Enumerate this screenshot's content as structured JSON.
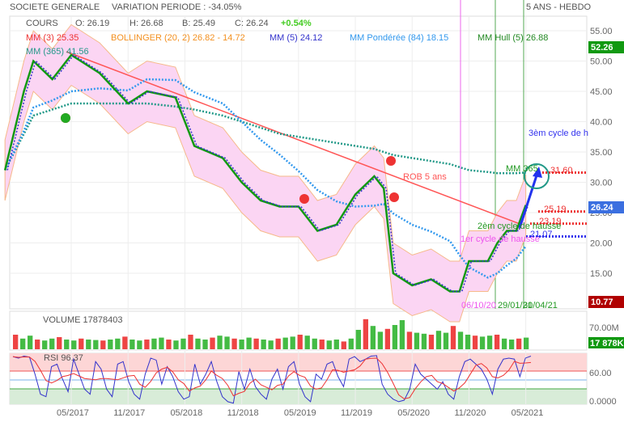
{
  "header": {
    "title": "SOCIETE GENERALE",
    "variation": "VARIATION PERIODE : -34.05%",
    "period": "5 ANS - HEBDO"
  },
  "quote": {
    "label": "COURS",
    "open": "O: 26.19",
    "high": "H: 26.68",
    "low": "B: 25.49",
    "close": "C: 26.24",
    "change": "+0.54%"
  },
  "indicators": {
    "mm3": "MM (3)  25.35",
    "bollinger": "BOLLINGER (20, 2)  26.82 - 14.72",
    "mm5": "MM (5)  24.12",
    "mmp": "MM Pondérée (84)  18.15",
    "hull": "MM Hull (5)  26.88",
    "mm365": "MM (365)  41.56"
  },
  "price_axis": [
    "55.00",
    "50.00",
    "45.00",
    "40.00",
    "35.00",
    "30.00",
    "25.00",
    "20.00",
    "15.00"
  ],
  "price_badges": {
    "top": "52.26",
    "last": "26.24",
    "low": "10.77"
  },
  "annotations": {
    "rob": "ROB  5 ans",
    "mm365": "MM 365",
    "cycle1": "1er cycle de hausse",
    "cycle2": "2èm cycle de hausse",
    "cycle3": "3èm cycle de h",
    "lvl3160": "31.60",
    "lvl2519": "25.19",
    "lvl2319": "23.19",
    "lvl2107": "21.07",
    "d1": "06/10/20",
    "d2": "29/01/21",
    "d3": "30/04/21"
  },
  "volume": {
    "label": "VOLUME 17878403",
    "axis": "70.00M",
    "badge": "17 878K",
    "values": [
      30,
      22,
      28,
      20,
      18,
      22,
      25,
      20,
      18,
      22,
      20,
      19,
      18,
      20,
      22,
      26,
      20,
      18,
      20,
      22,
      24,
      20,
      18,
      22,
      30,
      22,
      20,
      24,
      28,
      26,
      22,
      20,
      24,
      22,
      20,
      18,
      22,
      24,
      26,
      30,
      28,
      22,
      20,
      18,
      20,
      16,
      22,
      40,
      62,
      48,
      36,
      42,
      50,
      60,
      36,
      34,
      32,
      30,
      38,
      34,
      48,
      36,
      30,
      28,
      26,
      28,
      30,
      22,
      20,
      22,
      24
    ]
  },
  "rsi": {
    "label": "RSI  96.37",
    "axis_mid": "60.00",
    "axis_low": "0.0000",
    "values": [
      95,
      92,
      96,
      94,
      60,
      20,
      15,
      75,
      80,
      50,
      25,
      90,
      60,
      30,
      20,
      85,
      70,
      30,
      15,
      80,
      85,
      45,
      20,
      10,
      60,
      92,
      88,
      40,
      75,
      55,
      25,
      10,
      15,
      80,
      40,
      60,
      85,
      45,
      15,
      5,
      2,
      65,
      30,
      70,
      35,
      20,
      10,
      50,
      70,
      30,
      75,
      85,
      40,
      15,
      5,
      60,
      50,
      80,
      85,
      55,
      35,
      90,
      95,
      85,
      90,
      96,
      97,
      40,
      20,
      10,
      5,
      8,
      30,
      80,
      60,
      50,
      40,
      30,
      45,
      20,
      10,
      55,
      85,
      90,
      80,
      70,
      50,
      20,
      70,
      90,
      92,
      90,
      55,
      92,
      96
    ]
  },
  "time_axis": [
    "05/2017",
    "11/2017",
    "05/2018",
    "11/2018",
    "05/2019",
    "11/2019",
    "05/2020",
    "11/2020",
    "05/2021"
  ],
  "chart_data": {
    "type": "line",
    "title": "SOCIETE GENERALE 5 ANS - HEBDO",
    "x": [
      "10/2016",
      "12/2016",
      "01/2017",
      "03/2017",
      "05/2017",
      "08/2017",
      "11/2017",
      "01/2018",
      "04/2018",
      "06/2018",
      "09/2018",
      "11/2018",
      "01/2019",
      "03/2019",
      "05/2019",
      "07/2019",
      "09/2019",
      "11/2019",
      "01/2020",
      "02/2020",
      "03/2020",
      "05/2020",
      "07/2020",
      "09/2020",
      "10/2020",
      "11/2020",
      "01/2021",
      "02/2021",
      "03/2021",
      "04/2021",
      "05/2021"
    ],
    "month_index": [
      0,
      2,
      3,
      5,
      7,
      10,
      13,
      15,
      18,
      20,
      23,
      25,
      27,
      29,
      31,
      33,
      35,
      37,
      39,
      40,
      41,
      43,
      45,
      47,
      48,
      49,
      51,
      52,
      53,
      54,
      55
    ],
    "close": [
      32,
      45,
      50,
      47,
      51,
      48,
      43,
      45,
      44,
      36,
      34,
      30,
      27,
      26,
      26,
      22,
      23,
      28,
      31,
      29,
      15,
      13,
      14,
      12,
      12,
      17,
      17,
      20,
      22,
      22,
      26.24
    ],
    "mm365": [
      32,
      38,
      41,
      42,
      43,
      43,
      43,
      43,
      42.5,
      42,
      41,
      40,
      39,
      38,
      37.5,
      37,
      36.5,
      36,
      35.5,
      35,
      34.5,
      34,
      33.5,
      33,
      32.5,
      32,
      31.7,
      31.5,
      31.5,
      31.5,
      31.6
    ],
    "ylim": [
      10,
      57
    ]
  }
}
